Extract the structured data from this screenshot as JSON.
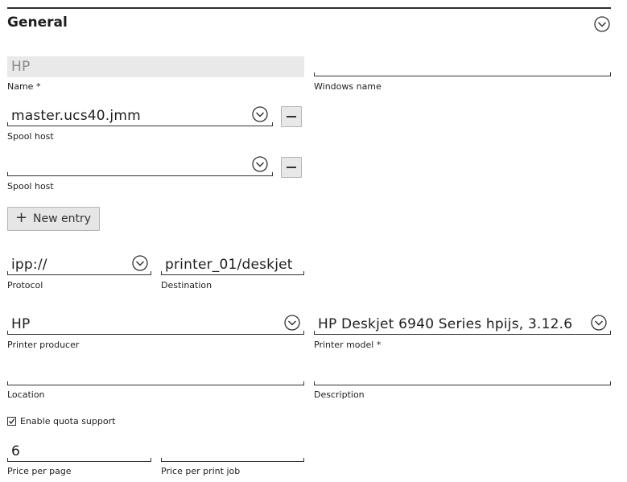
{
  "section": {
    "title": "General",
    "collapse_icon": "chevron-down-circle-icon"
  },
  "name": {
    "value": "HP",
    "label": "Name *"
  },
  "windows_name": {
    "value": "",
    "label": "Windows name"
  },
  "spool_hosts": [
    {
      "value": "master.ucs40.jmm",
      "label": "Spool host"
    },
    {
      "value": "",
      "label": "Spool host"
    }
  ],
  "new_entry": {
    "label": "New entry",
    "icon": "plus-icon"
  },
  "protocol": {
    "value": "ipp://",
    "label": "Protocol"
  },
  "destination": {
    "value": "printer_01/deskjet",
    "label": "Destination"
  },
  "printer_producer": {
    "value": "HP",
    "label": "Printer producer"
  },
  "printer_model": {
    "value": "HP Deskjet 6940 Series hpijs, 3.12.6",
    "label": "Printer model *"
  },
  "location": {
    "value": "",
    "label": "Location"
  },
  "description": {
    "value": "",
    "label": "Description"
  },
  "quota": {
    "label": "Enable quota support",
    "checked": true
  },
  "price_per_page": {
    "value": "6",
    "label": "Price per page"
  },
  "price_per_print_job": {
    "value": "",
    "label": "Price per print job"
  }
}
